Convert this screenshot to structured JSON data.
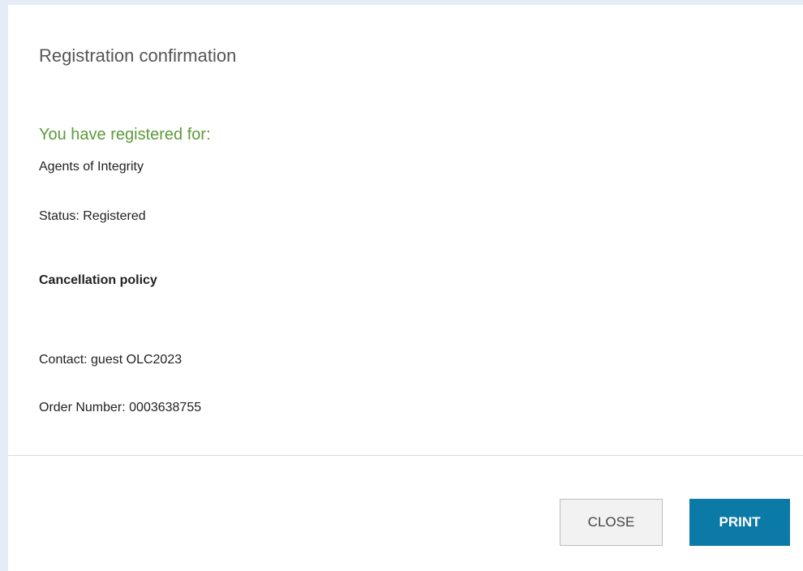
{
  "dialog": {
    "title": "Registration confirmation",
    "registered_heading": "You have registered for:",
    "event_name": "Agents of Integrity",
    "status": "Status: Registered",
    "cancellation_policy": "Cancellation policy",
    "contact": "Contact: guest OLC2023",
    "order_number": "Order Number: 0003638755"
  },
  "buttons": {
    "close_label": "CLOSE",
    "print_label": "PRINT"
  },
  "colors": {
    "page_background": "#e3ecf7",
    "heading_green": "#5e9a3a",
    "print_button": "#0b7aa6"
  }
}
